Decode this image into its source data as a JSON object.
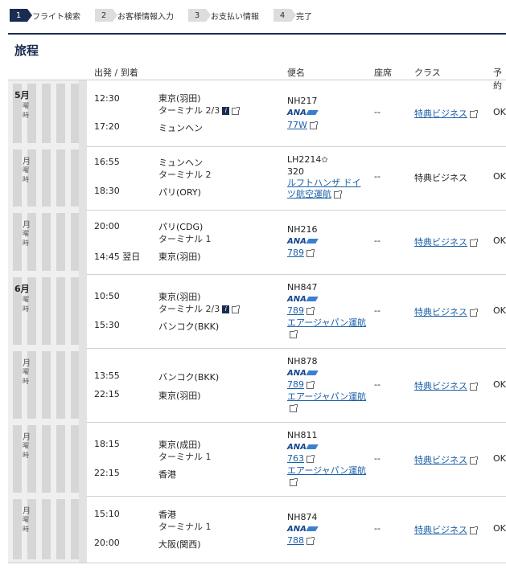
{
  "steps": [
    {
      "num": "1",
      "label": "フライト検索"
    },
    {
      "num": "2",
      "label": "お客様情報入力"
    },
    {
      "num": "3",
      "label": "お支払い情報"
    },
    {
      "num": "4",
      "label": "完了"
    }
  ],
  "page_title": "旅程",
  "headers": {
    "dep_arr": "出発 / 到着",
    "flight": "便名",
    "seat": "座席",
    "class": "クラス",
    "status": "予約"
  },
  "date_labels": {
    "may": "5月",
    "june": "6月",
    "month_short": "月",
    "dow": "曜",
    "time_suffix": "時"
  },
  "flights": [
    {
      "dep_time": "12:30",
      "dep_city": "東京(羽田)",
      "dep_term": "ターミナル 2/3",
      "arr_time": "17:20",
      "arr_city": "ミュンヘン",
      "arr_term": "",
      "flight_no": "NH217",
      "carrier": "ANA",
      "aircraft": "77W",
      "operator": "",
      "seat": "--",
      "class": "特典ビジネス",
      "status": "OK"
    },
    {
      "dep_time": "16:55",
      "dep_city": "ミュンヘン",
      "dep_term": "ターミナル 2",
      "arr_time": "18:30",
      "arr_city": "パリ(ORY)",
      "arr_term": "",
      "flight_no": "LH2214",
      "carrier": "",
      "aircraft": "320",
      "operator": "ルフトハンザ ドイツ航空運航",
      "seat": "--",
      "class": "特典ビジネス",
      "status": "OK"
    },
    {
      "dep_time": "20:00",
      "dep_city": "パリ(CDG)",
      "dep_term": "ターミナル 1",
      "arr_time": "14:45 翌日",
      "arr_city": "東京(羽田)",
      "arr_term": "",
      "flight_no": "NH216",
      "carrier": "ANA",
      "aircraft": "789",
      "operator": "",
      "seat": "--",
      "class": "特典ビジネス",
      "status": "OK"
    },
    {
      "dep_time": "10:50",
      "dep_city": "東京(羽田)",
      "dep_term": "ターミナル 2/3",
      "arr_time": "15:30",
      "arr_city": "バンコク(BKK)",
      "arr_term": "",
      "flight_no": "NH847",
      "carrier": "ANA",
      "aircraft": "789",
      "operator": "エアージャパン運航",
      "seat": "--",
      "class": "特典ビジネス",
      "status": "OK"
    },
    {
      "dep_time": "13:55",
      "dep_city": "バンコク(BKK)",
      "dep_term": "",
      "arr_time": "22:15",
      "arr_city": "東京(羽田)",
      "arr_term": "",
      "flight_no": "NH878",
      "carrier": "ANA",
      "aircraft": "789",
      "operator": "エアージャパン運航",
      "seat": "--",
      "class": "特典ビジネス",
      "status": "OK"
    },
    {
      "dep_time": "18:15",
      "dep_city": "東京(成田)",
      "dep_term": "ターミナル 1",
      "arr_time": "22:15",
      "arr_city": "香港",
      "arr_term": "",
      "flight_no": "NH811",
      "carrier": "ANA",
      "aircraft": "763",
      "operator": "エアージャパン運航",
      "seat": "--",
      "class": "特典ビジネス",
      "status": "OK"
    },
    {
      "dep_time": "15:10",
      "dep_city": "香港",
      "dep_term": "ターミナル 1",
      "arr_time": "20:00",
      "arr_city": "大阪(関西)",
      "arr_term": "",
      "flight_no": "NH874",
      "carrier": "ANA",
      "aircraft": "788",
      "operator": "",
      "seat": "--",
      "class": "特典ビジネス",
      "status": "OK"
    }
  ]
}
